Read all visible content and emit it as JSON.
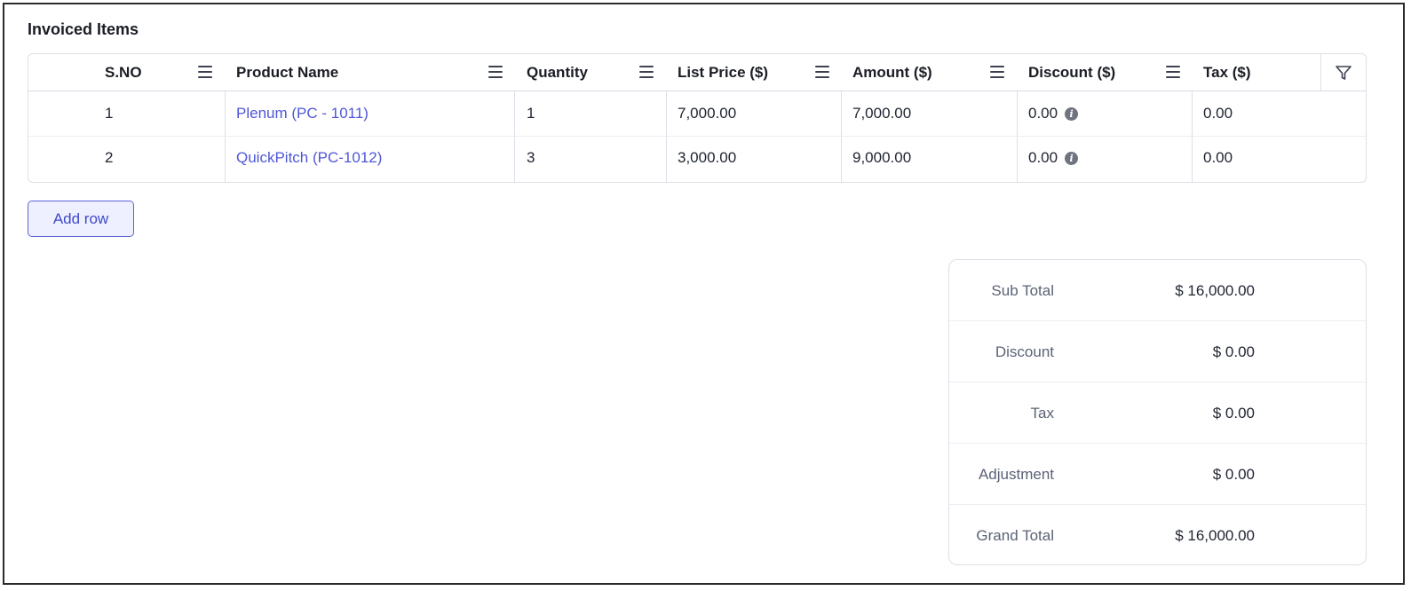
{
  "section": {
    "title": "Invoiced Items"
  },
  "table": {
    "columns": [
      {
        "label": "S.NO"
      },
      {
        "label": "Product Name"
      },
      {
        "label": "Quantity"
      },
      {
        "label": "List Price ($)"
      },
      {
        "label": "Amount ($)"
      },
      {
        "label": "Discount ($)"
      },
      {
        "label": "Tax ($)"
      }
    ],
    "rows": [
      {
        "sno": "1",
        "product": "Plenum (PC - 1011)",
        "quantity": "1",
        "list_price": "7,000.00",
        "amount": "7,000.00",
        "discount": "0.00",
        "tax": "0.00"
      },
      {
        "sno": "2",
        "product": "QuickPitch (PC-1012)",
        "quantity": "3",
        "list_price": "3,000.00",
        "amount": "9,000.00",
        "discount": "0.00",
        "tax": "0.00"
      }
    ],
    "icons": {
      "column_menu": "hamburger-menu-icon",
      "filter": "filter-icon",
      "discount_info": "info-icon"
    }
  },
  "actions": {
    "add_row_label": "Add row"
  },
  "totals": [
    {
      "label": "Sub Total",
      "value": "$ 16,000.00"
    },
    {
      "label": "Discount",
      "value": "$ 0.00"
    },
    {
      "label": "Tax",
      "value": "$ 0.00"
    },
    {
      "label": "Adjustment",
      "value": "$ 0.00"
    },
    {
      "label": "Grand Total",
      "value": "$ 16,000.00"
    }
  ],
  "colors": {
    "link": "#4f57d6",
    "button_border": "#5b63d9",
    "button_bg": "#eef0ff",
    "border": "#dcdfe6"
  }
}
